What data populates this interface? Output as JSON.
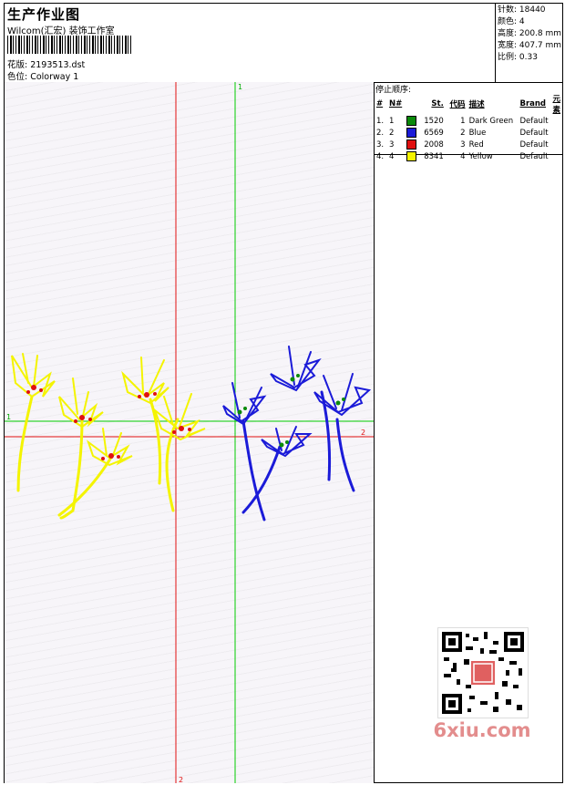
{
  "header": {
    "title": "生产作业图",
    "company": "Wilcom(汇宏) 装饰工作室",
    "design_label": "花版: 2193513.dst",
    "colorway_label": "色位:  Colorway 1"
  },
  "stats": [
    "针数:  18440",
    "颜色:  4",
    "高度:  200.8 mm",
    "宽度:  407.7 mm",
    "比例:  0.33"
  ],
  "stop_sequence": {
    "title": "停止顺序:",
    "headers": [
      "#",
      "N#",
      "St.",
      "代码",
      "描述",
      "Brand",
      "元素"
    ],
    "rows": [
      {
        "n": "1.",
        "nn": "1",
        "st": "1520",
        "code": "1",
        "desc": "Dark Green",
        "brand": "Default",
        "color": "#0a8a0a"
      },
      {
        "n": "2.",
        "nn": "2",
        "st": "6569",
        "code": "2",
        "desc": "Blue",
        "brand": "Default",
        "color": "#1b1bd8"
      },
      {
        "n": "3.",
        "nn": "3",
        "st": "2008",
        "code": "3",
        "desc": "Red",
        "brand": "Default",
        "color": "#e01010"
      },
      {
        "n": "4.",
        "nn": "4",
        "st": "8341",
        "code": "4",
        "desc": "Yellow",
        "brand": "Default",
        "color": "#f4f400"
      }
    ]
  },
  "axes": {
    "green_v_label": "1",
    "green_h_label": "1",
    "red_h_label": "2",
    "red_v_label": "2"
  },
  "watermark": {
    "text": "6xiu.com"
  }
}
